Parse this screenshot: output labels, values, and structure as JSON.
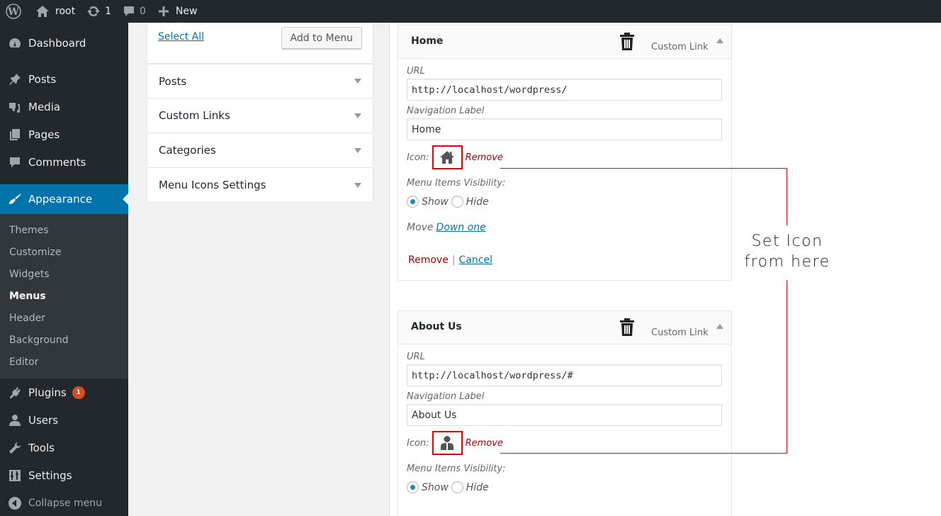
{
  "admin_bar": {
    "site_name": "root",
    "updates_count": "1",
    "comments_count": "0",
    "new_label": "New",
    "icons": [
      "wordpress-logo-icon",
      "home-icon",
      "updates-icon",
      "comment-icon",
      "plus-icon"
    ]
  },
  "sidebar": {
    "items": [
      {
        "label": "Dashboard",
        "icon": "dashboard-icon"
      },
      {
        "label": "Posts",
        "icon": "pin-icon"
      },
      {
        "label": "Media",
        "icon": "media-icon"
      },
      {
        "label": "Pages",
        "icon": "pages-icon"
      },
      {
        "label": "Comments",
        "icon": "comment-icon"
      },
      {
        "label": "Appearance",
        "icon": "paintbrush-icon",
        "current": true
      },
      {
        "label": "Plugins",
        "icon": "plugin-icon",
        "badge": "1"
      },
      {
        "label": "Users",
        "icon": "user-icon"
      },
      {
        "label": "Tools",
        "icon": "wrench-icon"
      },
      {
        "label": "Settings",
        "icon": "sliders-icon"
      }
    ],
    "submenu": [
      "Themes",
      "Customize",
      "Widgets",
      "Menus",
      "Header",
      "Background",
      "Editor"
    ],
    "submenu_current": "Menus",
    "collapse_label": "Collapse menu",
    "accent_color": "#0073aa",
    "badge_color": "#d54e21"
  },
  "metaboxes": {
    "select_all": "Select All",
    "add_to_menu": "Add to Menu",
    "sections": [
      "Posts",
      "Custom Links",
      "Categories",
      "Menu Icons Settings"
    ]
  },
  "menu_items": [
    {
      "title": "Home",
      "type": "Custom Link",
      "url_label": "URL",
      "url": "http://localhost/wordpress/",
      "nav_label_label": "Navigation Label",
      "nav_label": "Home",
      "icon_label": "Icon:",
      "icon": "home-icon",
      "icon_remove": "Remove",
      "visibility_label": "Menu Items Visibility:",
      "visibility_options": [
        "Show",
        "Hide"
      ],
      "visibility_selected": "Show",
      "move_label": "Move",
      "move_link": "Down one",
      "remove_label": "Remove",
      "separator": "|",
      "cancel_label": "Cancel"
    },
    {
      "title": "About Us",
      "type": "Custom Link",
      "url_label": "URL",
      "url": "http://localhost/wordpress/#",
      "nav_label_label": "Navigation Label",
      "nav_label": "About Us",
      "icon_label": "Icon:",
      "icon": "user-icon",
      "icon_remove": "Remove",
      "visibility_label": "Menu Items Visibility:",
      "visibility_options": [
        "Show",
        "Hide"
      ],
      "visibility_selected": "Show"
    }
  ],
  "annotation": {
    "line1": "Set Icon",
    "line2": "from here",
    "color": "#e00000"
  }
}
